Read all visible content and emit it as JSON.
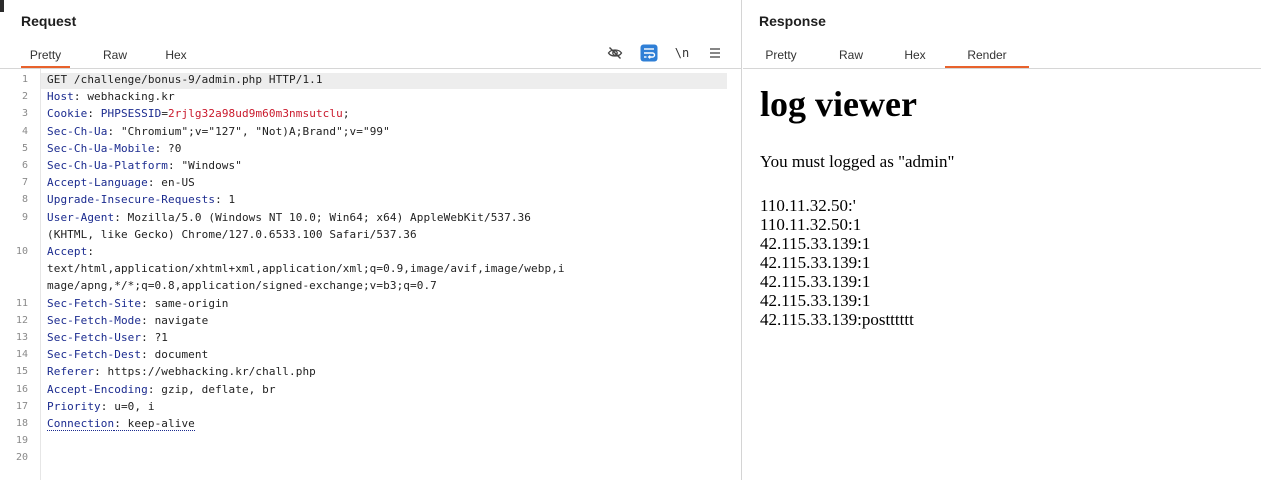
{
  "request": {
    "title": "Request",
    "tabs": [
      {
        "label": "Pretty",
        "active": true
      },
      {
        "label": "Raw",
        "active": false
      },
      {
        "label": "Hex",
        "active": false
      }
    ],
    "toolbar": {
      "hide_icon": "eye-slash-icon",
      "wrap_icon": "wrap-lines-icon",
      "newline_label": "\\n",
      "menu_icon": "hamburger-menu-icon"
    },
    "line_numbers": [
      "1",
      "2",
      "3",
      "4",
      "5",
      "6",
      "7",
      "8",
      "9",
      "10",
      "11",
      "12",
      "13",
      "14",
      "15",
      "16",
      "17",
      "18",
      "19",
      "20"
    ],
    "lines": [
      {
        "n": "1",
        "parts": [
          {
            "t": "GET /challenge/bonus-9/admin.php HTTP/1.1",
            "c": "p"
          }
        ]
      },
      {
        "n": "2",
        "parts": [
          {
            "t": "Host",
            "c": "k"
          },
          {
            "t": ": webhacking.kr",
            "c": "p"
          }
        ]
      },
      {
        "n": "3",
        "parts": [
          {
            "t": "Cookie",
            "c": "k"
          },
          {
            "t": ": ",
            "c": "p"
          },
          {
            "t": "PHPSESSID",
            "c": "k"
          },
          {
            "t": "=",
            "c": "p"
          },
          {
            "t": "2rjlg32a98ud9m60m3nmsutclu",
            "c": "cv"
          },
          {
            "t": ";",
            "c": "p"
          }
        ]
      },
      {
        "n": "4",
        "parts": [
          {
            "t": "Sec-Ch-Ua",
            "c": "k"
          },
          {
            "t": ": \"Chromium\";v=\"127\", \"Not)A;Brand\";v=\"99\"",
            "c": "p"
          }
        ]
      },
      {
        "n": "5",
        "parts": [
          {
            "t": "Sec-Ch-Ua-Mobile",
            "c": "k"
          },
          {
            "t": ": ?0",
            "c": "p"
          }
        ]
      },
      {
        "n": "6",
        "parts": [
          {
            "t": "Sec-Ch-Ua-Platform",
            "c": "k"
          },
          {
            "t": ": \"Windows\"",
            "c": "p"
          }
        ]
      },
      {
        "n": "7",
        "parts": [
          {
            "t": "Accept-Language",
            "c": "k"
          },
          {
            "t": ": en-US",
            "c": "p"
          }
        ]
      },
      {
        "n": "8",
        "parts": [
          {
            "t": "Upgrade-Insecure-Requests",
            "c": "k"
          },
          {
            "t": ": 1",
            "c": "p"
          }
        ]
      },
      {
        "n": "9",
        "parts": [
          {
            "t": "User-Agent",
            "c": "k"
          },
          {
            "t": ": Mozilla/5.0 (Windows NT 10.0; Win64; x64) AppleWebKit/537.36",
            "c": "p"
          }
        ]
      },
      {
        "n": "",
        "parts": [
          {
            "t": "(KHTML, like Gecko) Chrome/127.0.6533.100 Safari/537.36",
            "c": "p"
          }
        ]
      },
      {
        "n": "10",
        "parts": [
          {
            "t": "Accept",
            "c": "k"
          },
          {
            "t": ":",
            "c": "p"
          }
        ]
      },
      {
        "n": "",
        "parts": [
          {
            "t": "text/html,application/xhtml+xml,application/xml;q=0.9,image/avif,image/webp,i",
            "c": "p"
          }
        ]
      },
      {
        "n": "",
        "parts": [
          {
            "t": "mage/apng,*/*;q=0.8,application/signed-exchange;v=b3;q=0.7",
            "c": "p"
          }
        ]
      },
      {
        "n": "11",
        "parts": [
          {
            "t": "Sec-Fetch-Site",
            "c": "k"
          },
          {
            "t": ": same-origin",
            "c": "p"
          }
        ]
      },
      {
        "n": "12",
        "parts": [
          {
            "t": "Sec-Fetch-Mode",
            "c": "k"
          },
          {
            "t": ": navigate",
            "c": "p"
          }
        ]
      },
      {
        "n": "13",
        "parts": [
          {
            "t": "Sec-Fetch-User",
            "c": "k"
          },
          {
            "t": ": ?1",
            "c": "p"
          }
        ]
      },
      {
        "n": "14",
        "parts": [
          {
            "t": "Sec-Fetch-Dest",
            "c": "k"
          },
          {
            "t": ": document",
            "c": "p"
          }
        ]
      },
      {
        "n": "15",
        "parts": [
          {
            "t": "Referer",
            "c": "k"
          },
          {
            "t": ": https://webhacking.kr/chall.php",
            "c": "p"
          }
        ]
      },
      {
        "n": "16",
        "parts": [
          {
            "t": "Accept-Encoding",
            "c": "k"
          },
          {
            "t": ": gzip, deflate, br",
            "c": "p"
          }
        ]
      },
      {
        "n": "17",
        "parts": [
          {
            "t": "Priority",
            "c": "k"
          },
          {
            "t": ": u=0, i",
            "c": "p"
          }
        ]
      },
      {
        "n": "18",
        "parts": [
          {
            "t": "Connection",
            "c": "k"
          },
          {
            "t": ": keep-alive",
            "c": "p"
          }
        ]
      },
      {
        "n": "19",
        "parts": []
      },
      {
        "n": "20",
        "parts": []
      }
    ]
  },
  "response": {
    "title": "Response",
    "tabs": [
      {
        "label": "Pretty",
        "active": false
      },
      {
        "label": "Raw",
        "active": false
      },
      {
        "label": "Hex",
        "active": false
      },
      {
        "label": "Render",
        "active": true
      }
    ],
    "render": {
      "heading": "log viewer",
      "message": "You must logged as \"admin\"",
      "logs": [
        "110.11.32.50:'",
        "110.11.32.50:1",
        "42.115.33.139:1",
        "42.115.33.139:1",
        "42.115.33.139:1",
        "42.115.33.139:1",
        "42.115.33.139:postttttt"
      ]
    }
  },
  "colors": {
    "accent_tab": "#e8622c",
    "header_name": "#1b2b8f",
    "cookie_value": "#c9182b",
    "wrap_icon_bg": "#2f7fd6"
  }
}
